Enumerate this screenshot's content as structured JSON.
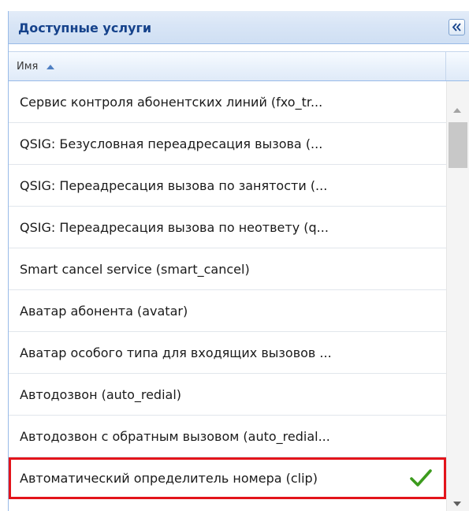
{
  "panel": {
    "title": "Доступные услуги",
    "collapse_icon": "double-chevron-left-icon"
  },
  "grid": {
    "column_header": "Имя",
    "sort_direction": "ascending",
    "rows": [
      {
        "label": "Сервис контроля абонентских линий (fxo_tr..."
      },
      {
        "label": "QSIG: Безусловная переадресация вызова (..."
      },
      {
        "label": "QSIG: Переадресация вызова по занятости (..."
      },
      {
        "label": "QSIG: Переадресация вызова по неответу (q..."
      },
      {
        "label": "Smart cancel service (smart_cancel)"
      },
      {
        "label": "Аватар абонента (avatar)"
      },
      {
        "label": "Аватар особого типа для входящих вызовов ..."
      },
      {
        "label": "Автодозвон (auto_redial)"
      },
      {
        "label": "Автодозвон с обратным вызовом (auto_redial..."
      },
      {
        "label": "Автоматический определитель номера (clip)",
        "selected": true,
        "icon": "check-icon"
      }
    ]
  },
  "colors": {
    "title_text": "#15428b",
    "selection_border": "#e3141b",
    "check": "#3c9b1d"
  }
}
